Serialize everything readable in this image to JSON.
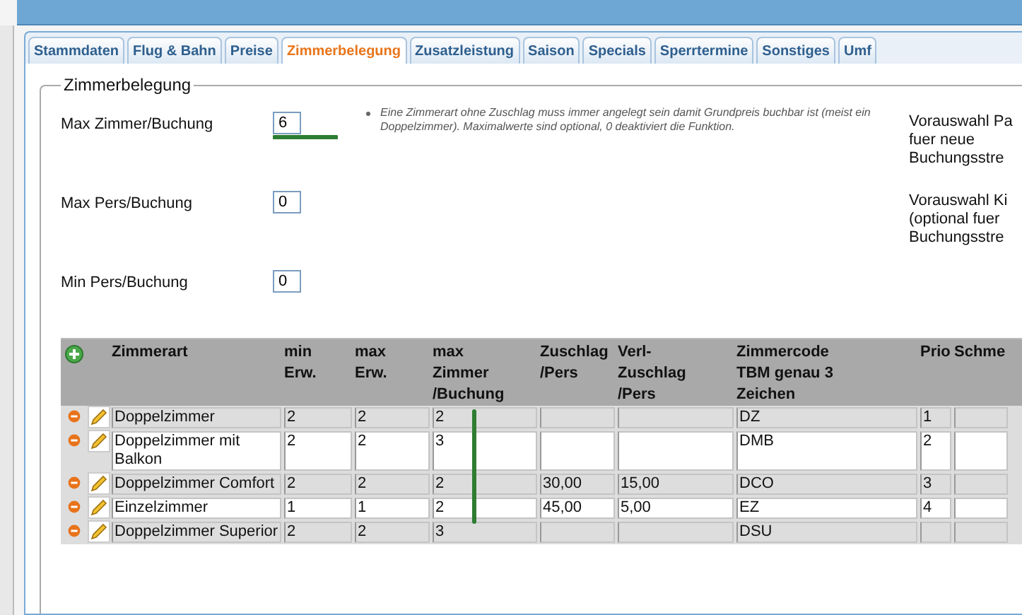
{
  "tabs": [
    {
      "label": "Stammdaten",
      "selected": false
    },
    {
      "label": "Flug & Bahn",
      "selected": false
    },
    {
      "label": "Preise",
      "selected": false
    },
    {
      "label": "Zimmerbelegung",
      "selected": true
    },
    {
      "label": "Zusatzleistung",
      "selected": false
    },
    {
      "label": "Saison",
      "selected": false
    },
    {
      "label": "Specials",
      "selected": false
    },
    {
      "label": "Sperrtermine",
      "selected": false
    },
    {
      "label": "Sonstiges",
      "selected": false
    },
    {
      "label": "Umf",
      "selected": false
    }
  ],
  "legend": "Zimmerbelegung",
  "fields": [
    {
      "label": "Max Zimmer/Buchung",
      "value": "6"
    },
    {
      "label": "Max Pers/Buchung",
      "value": "0"
    },
    {
      "label": "Min Pers/Buchung",
      "value": "0"
    }
  ],
  "hint": "Eine Zimmerart ohne Zuschlag muss immer angelegt sein damit Grundpreis buchbar ist (meist ein Doppelzimmer). Maximalwerte sind optional, 0 deaktiviert die Funktion.",
  "side_notes": [
    [
      "Vorauswahl Pa",
      "fuer neue",
      "Buchungsstre"
    ],
    [
      "Vorauswahl Ki",
      "(optional fuer",
      "Buchungsstre"
    ]
  ],
  "table": {
    "columns": [
      "Zimmerart",
      "min\nErw.",
      "max\nErw.",
      "max\nZimmer\n/Buchung",
      "Zuschlag\n/Pers",
      "Verl-\nZuschlag\n/Pers",
      "Zimmercode\nTBM genau 3\nZeichen",
      "Prio",
      "Schme"
    ],
    "rows": [
      [
        "Doppelzimmer",
        "2",
        "2",
        "2",
        "",
        "",
        "DZ",
        "1"
      ],
      [
        "Doppelzimmer mit Balkon",
        "2",
        "2",
        "3",
        "",
        "",
        "DMB",
        "2"
      ],
      [
        "Doppelzimmer Comfort",
        "2",
        "2",
        "2",
        "30,00",
        "15,00",
        "DCO",
        "3"
      ],
      [
        "Einzelzimmer",
        "1",
        "1",
        "2",
        "45,00",
        "5,00",
        "EZ",
        "4"
      ],
      [
        "Doppelzimmer Superior",
        "2",
        "2",
        "3",
        "",
        "",
        "DSU",
        ""
      ]
    ]
  }
}
